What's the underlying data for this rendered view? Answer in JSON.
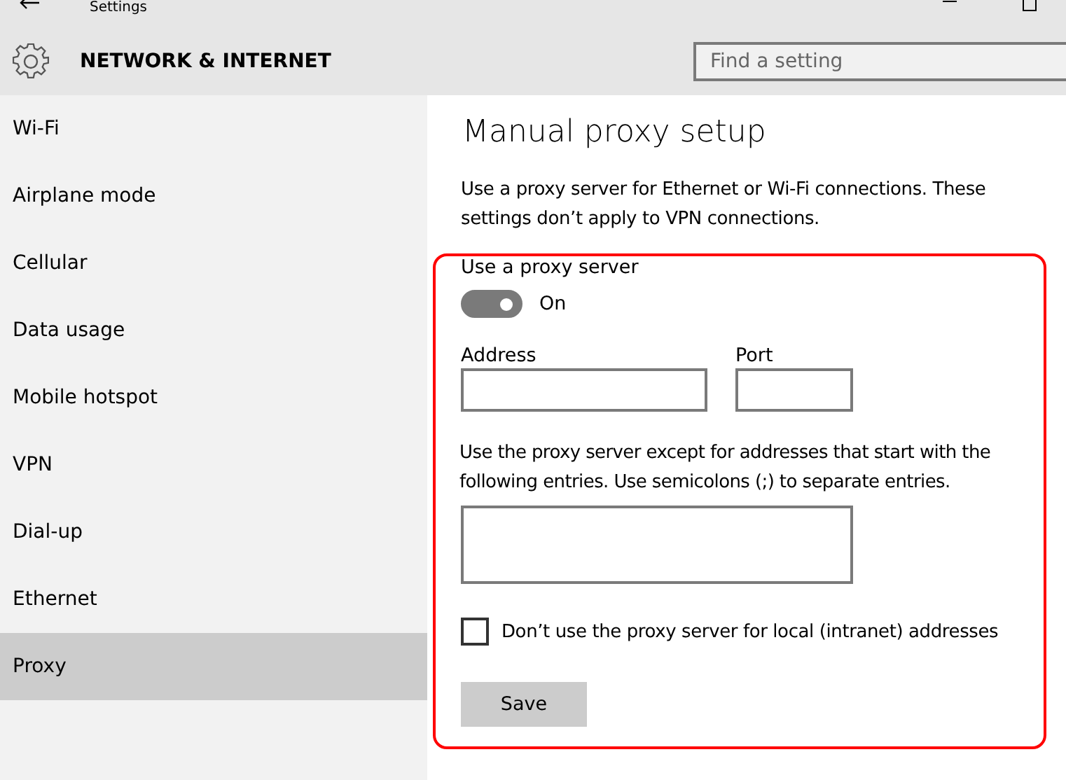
{
  "window": {
    "title": "Settings"
  },
  "header": {
    "title": "NETWORK & INTERNET",
    "search": {
      "placeholder": "Find a setting"
    }
  },
  "sidebar": {
    "items": [
      {
        "label": "Wi-Fi",
        "selected": false
      },
      {
        "label": "Airplane mode",
        "selected": false
      },
      {
        "label": "Cellular",
        "selected": false
      },
      {
        "label": "Data usage",
        "selected": false
      },
      {
        "label": "Mobile hotspot",
        "selected": false
      },
      {
        "label": "VPN",
        "selected": false
      },
      {
        "label": "Dial-up",
        "selected": false
      },
      {
        "label": "Ethernet",
        "selected": false
      },
      {
        "label": "Proxy",
        "selected": true
      }
    ]
  },
  "content": {
    "title": "Manual proxy setup",
    "description": "Use a proxy server for Ethernet or Wi-Fi connections. These settings don’t apply to VPN connections.",
    "proxy_toggle": {
      "label": "Use a proxy server",
      "on": true,
      "state_text": "On"
    },
    "address": {
      "label": "Address"
    },
    "port": {
      "label": "Port"
    },
    "exceptions": {
      "label": "Use the proxy server except for addresses that start with the following entries. Use semicolons (;) to separate entries."
    },
    "local_checkbox": {
      "label": "Don’t use the proxy server for local (intranet) addresses",
      "checked": false
    },
    "save_button": "Save"
  }
}
